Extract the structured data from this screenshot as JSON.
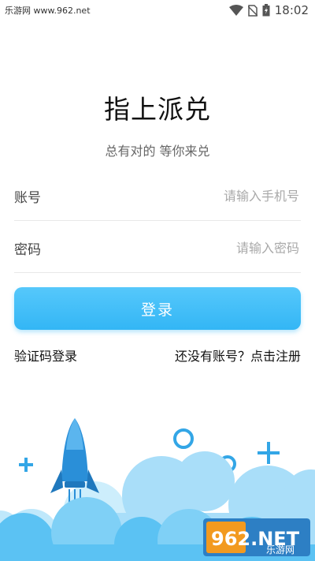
{
  "status_bar": {
    "site_text": "乐游网 www.962.net",
    "time": "18:02",
    "icons": [
      "wifi-icon",
      "no-sim-icon",
      "battery-charging-icon"
    ]
  },
  "app": {
    "title": "指上派兑",
    "subtitle": "总有对的 等你来兑"
  },
  "form": {
    "account_label": "账号",
    "account_placeholder": "请输入手机号",
    "password_label": "密码",
    "password_placeholder": "请输入密码",
    "login_button": "登录",
    "sms_login_link": "验证码登录",
    "register_link": "还没有账号？点击注册"
  },
  "watermark": {
    "top": "962.NET",
    "bottom": "乐游网"
  },
  "colors": {
    "accent": "#33b6f5",
    "cloud_light": "#bfe6fb",
    "cloud_mid": "#7fd0f6",
    "rocket": "#2a8fd8",
    "watermark_orange": "#f29a1f"
  }
}
